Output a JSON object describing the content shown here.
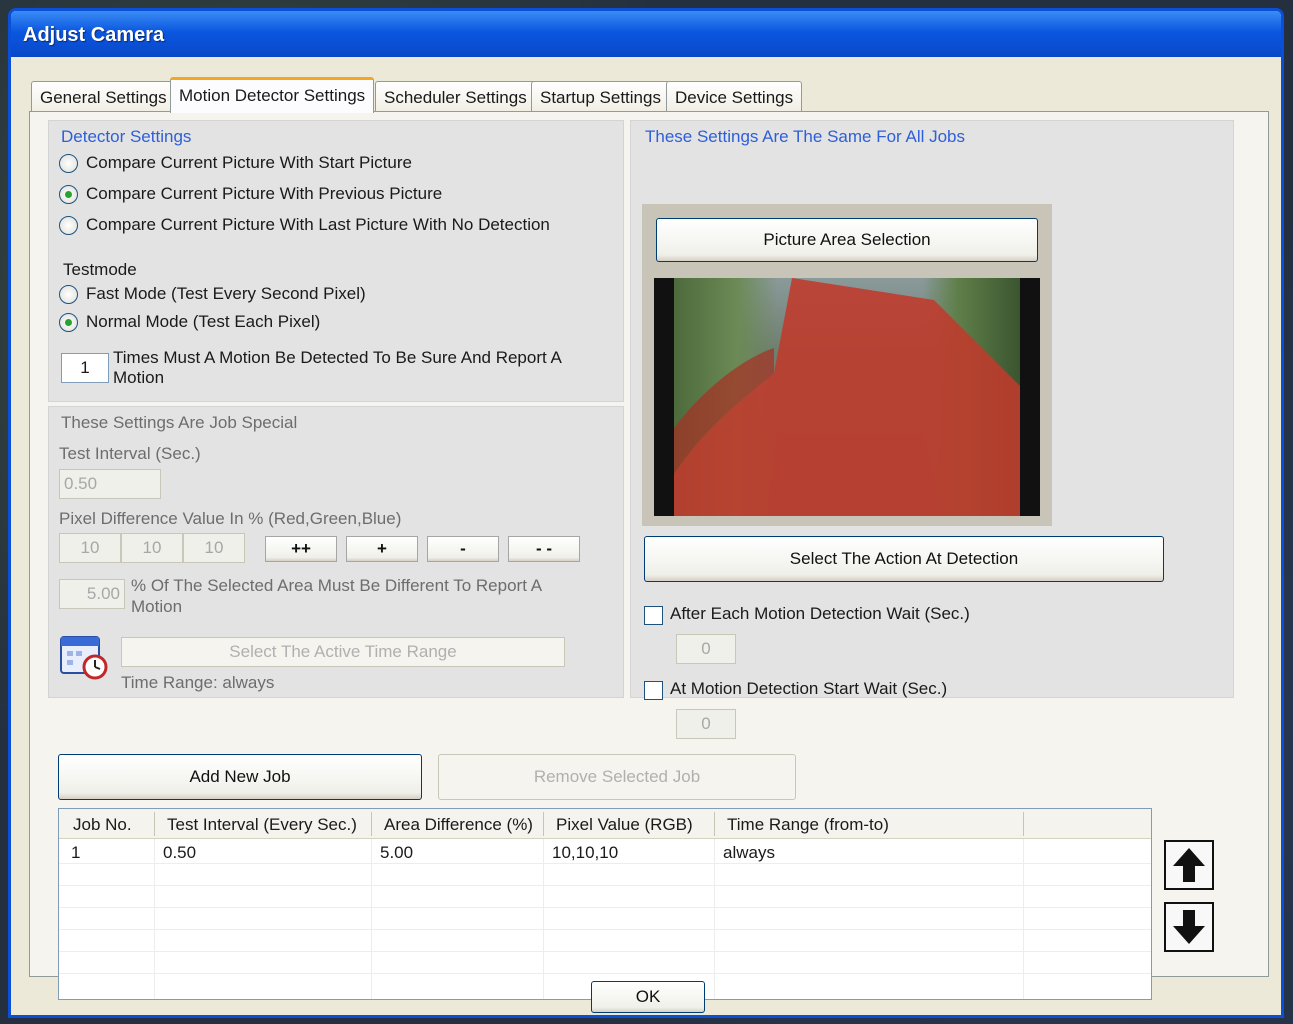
{
  "window": {
    "title": "Adjust Camera"
  },
  "tabs": [
    {
      "label": "General Settings"
    },
    {
      "label": "Motion Detector Settings"
    },
    {
      "label": "Scheduler Settings"
    },
    {
      "label": "Startup Settings"
    },
    {
      "label": "Device Settings"
    }
  ],
  "detector": {
    "title": "Detector Settings",
    "options": [
      "Compare Current Picture With Start Picture",
      "Compare Current Picture With Previous Picture",
      "Compare Current Picture With Last Picture With No Detection"
    ],
    "selected_option": 1,
    "testmode_label": "Testmode",
    "testmodes": [
      "Fast Mode (Test Every Second Pixel)",
      "Normal Mode (Test Each Pixel)"
    ],
    "selected_testmode": 1,
    "times_value": "1",
    "times_label_1": "Times Must A Motion Be Detected To Be Sure And Report A",
    "times_label_2": "Motion"
  },
  "job": {
    "title": "These Settings Are Job Special",
    "interval_label": "Test Interval (Sec.)",
    "interval_value": "0.50",
    "pixel_label": "Pixel Difference Value In % (Red,Green,Blue)",
    "pixel_values": [
      "10",
      "10",
      "10"
    ],
    "step_buttons": [
      "++",
      "+",
      "-",
      "- -"
    ],
    "area_value": "5.00",
    "area_label_1": "% Of The Selected Area Must Be Different To Report A",
    "area_label_2": "Motion",
    "time_range_button": "Select The Active Time Range",
    "time_range_text": "Time Range: always"
  },
  "all_jobs": {
    "title": "These Settings Are The Same For All Jobs",
    "picture_area_button": "Picture Area Selection",
    "action_button": "Select The Action At Detection",
    "after_wait_label": "After Each Motion Detection Wait (Sec.)",
    "after_wait_value": "0",
    "start_wait_label": "At Motion Detection Start Wait (Sec.)",
    "start_wait_value": "0"
  },
  "buttons": {
    "add_job": "Add New Job",
    "remove_job": "Remove Selected Job",
    "ok": "OK"
  },
  "table": {
    "columns": [
      "Job No.",
      "Test Interval (Every Sec.)",
      "Area Difference (%)",
      "Pixel Value (RGB)",
      "Time Range (from-to)"
    ],
    "rows": [
      [
        "1",
        "0.50",
        "5.00",
        "10,10,10",
        "always"
      ]
    ]
  },
  "colors": {
    "title_bar": "#0b57e0",
    "group_title_blue": "#2d5fd8",
    "detection_area": "#c03a2c"
  }
}
